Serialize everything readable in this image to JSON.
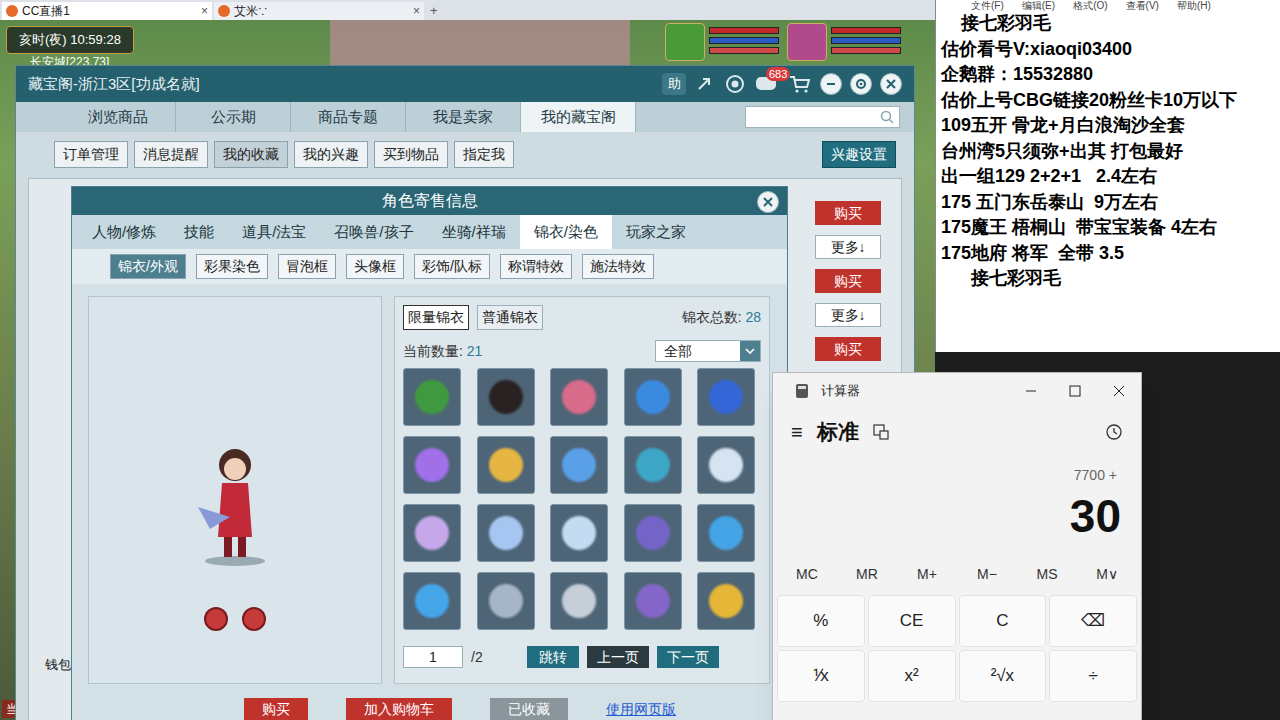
{
  "browser_tabs": [
    {
      "label": "CC直播1",
      "close": "×",
      "selected": true
    },
    {
      "label": "艾米∵",
      "close": "×",
      "selected": false
    }
  ],
  "new_tab": "+",
  "hud": {
    "time": "亥时(夜)  10:59:28",
    "location": "长安城[223,73]",
    "wallet": "钱包",
    "bottom_label": "当前"
  },
  "cbg": {
    "title": "藏宝阁-浙江3区[功成名就]",
    "help": "助",
    "badge": "683",
    "tabs": [
      {
        "label": "浏览商品",
        "selected": false
      },
      {
        "label": "公示期",
        "selected": false
      },
      {
        "label": "商品专题",
        "selected": false
      },
      {
        "label": "我是卖家",
        "selected": false
      },
      {
        "label": "我的藏宝阁",
        "selected": true
      }
    ],
    "subtabs": [
      {
        "label": "订单管理",
        "selected": false
      },
      {
        "label": "消息提醒",
        "selected": false
      },
      {
        "label": "我的收藏",
        "selected": true
      },
      {
        "label": "我的兴趣",
        "selected": false
      },
      {
        "label": "买到物品",
        "selected": false
      },
      {
        "label": "指定我",
        "selected": false
      }
    ],
    "interest_button": "兴趣设置",
    "list_actions": [
      {
        "kind": "buy",
        "label": "购买"
      },
      {
        "kind": "more",
        "label": "更多↓"
      },
      {
        "kind": "buy",
        "label": "购买"
      },
      {
        "kind": "more",
        "label": "更多↓"
      },
      {
        "kind": "buy",
        "label": "购买"
      }
    ]
  },
  "detail": {
    "title": "角色寄售信息",
    "tabs": [
      {
        "label": "人物/修炼",
        "selected": false
      },
      {
        "label": "技能",
        "selected": false
      },
      {
        "label": "道具/法宝",
        "selected": false
      },
      {
        "label": "召唤兽/孩子",
        "selected": false
      },
      {
        "label": "坐骑/祥瑞",
        "selected": false
      },
      {
        "label": "锦衣/染色",
        "selected": true
      },
      {
        "label": "玩家之家",
        "selected": false
      }
    ],
    "subtabs": [
      {
        "label": "锦衣/外观",
        "selected": true
      },
      {
        "label": "彩果染色",
        "selected": false
      },
      {
        "label": "冒泡框",
        "selected": false
      },
      {
        "label": "头像框",
        "selected": false
      },
      {
        "label": "彩饰/队标",
        "selected": false
      },
      {
        "label": "称谓特效",
        "selected": false
      },
      {
        "label": "施法特效",
        "selected": false
      }
    ],
    "outfit_types": [
      {
        "label": "限量锦衣",
        "selected": true
      },
      {
        "label": "普通锦衣",
        "selected": false
      }
    ],
    "total_label": "锦衣总数:",
    "total": "28",
    "count_label": "当前数量:",
    "count": "21",
    "filter": "全部",
    "items": [
      {
        "color": "#3f9a3f"
      },
      {
        "color": "#2a2222"
      },
      {
        "color": "#d86a8a"
      },
      {
        "color": "#3a8ae0"
      },
      {
        "color": "#3466d8"
      },
      {
        "color": "#a070e8"
      },
      {
        "color": "#e6b642"
      },
      {
        "color": "#5aa0e8"
      },
      {
        "color": "#3ea6c6"
      },
      {
        "color": "#d6e4f2"
      },
      {
        "color": "#c6a8ea"
      },
      {
        "color": "#a6c6f2"
      },
      {
        "color": "#c4dcf2"
      },
      {
        "color": "#7464c8"
      },
      {
        "color": "#44a4e6"
      },
      {
        "color": "#44a6e8"
      },
      {
        "color": "#a6b6c6"
      },
      {
        "color": "#c6ced8"
      },
      {
        "color": "#8466c8"
      },
      {
        "color": "#e6b636"
      }
    ],
    "page": "1",
    "pages": "/2",
    "jump": "跳转",
    "prev": "上一页",
    "next": "下一页",
    "actions": [
      {
        "kind": "buy",
        "label": "购买"
      },
      {
        "kind": "buy",
        "label": "加入购物车"
      },
      {
        "kind": "done",
        "label": "已收藏"
      },
      {
        "kind": "link",
        "label": "使用网页版"
      }
    ]
  },
  "notepad": {
    "menu": [
      "文件(F)",
      "编辑(E)",
      "格式(O)",
      "查看(V)",
      "帮助(H)"
    ],
    "lines": [
      "    接七彩羽毛",
      "估价看号V:xiaoqi03400",
      "企鹅群：15532880",
      "估价上号CBG链接20粉丝卡10万以下",
      "109五开 骨龙+月白浪淘沙全套",
      "台州湾5只须弥+出其 打包最好",
      "出一组129 2+2+1   2.4左右",
      "175 五门东岳泰山  9万左右",
      "175魔王 梧桐山  带宝宝装备 4左右",
      "175地府 将军  全带 3.5",
      "      接七彩羽毛"
    ]
  },
  "calculator": {
    "title": "计算器",
    "mode": "标准",
    "menu": "≡",
    "expression": "7700 +",
    "display": "30",
    "memory": [
      "MC",
      "MR",
      "M+",
      "M−",
      "MS",
      "M∨"
    ],
    "keys": [
      "%",
      "CE",
      "C",
      "⌫",
      "⅟x",
      "x²",
      "²√x",
      "÷"
    ]
  }
}
